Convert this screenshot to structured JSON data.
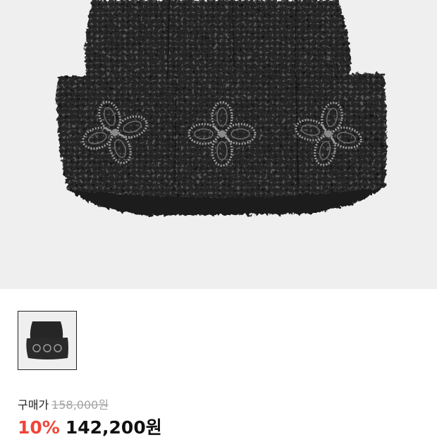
{
  "product": {
    "hero_image": "knit-beanie-photo",
    "thumbnails": [
      "knit-beanie-thumbnail"
    ]
  },
  "price": {
    "buy_label": "구매가",
    "original_price": "158,000원",
    "discount_rate": "10%",
    "sale_price": "142,200원"
  },
  "colors": {
    "hero_background": "#efefef",
    "discount": "#f04438",
    "strike_price": "#a3a3a3",
    "text_primary": "#111111"
  }
}
